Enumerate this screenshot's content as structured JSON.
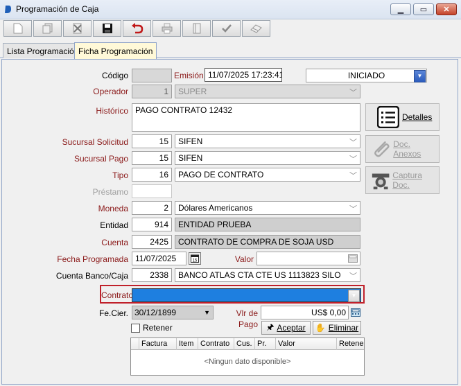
{
  "window": {
    "title": "Programación de Caja",
    "controls": {
      "minimize": "▁",
      "maximize": "▭",
      "close": "✕"
    }
  },
  "toolbar": {
    "buttons": [
      {
        "name": "new",
        "icon": "new-document-icon"
      },
      {
        "name": "copy",
        "icon": "copy-document-icon"
      },
      {
        "name": "delete",
        "icon": "delete-document-icon"
      },
      {
        "name": "save",
        "icon": "floppy-disk-icon"
      },
      {
        "name": "undo",
        "icon": "undo-arrow-icon"
      },
      {
        "name": "print",
        "icon": "printer-icon"
      },
      {
        "name": "attach",
        "icon": "notebook-icon"
      },
      {
        "name": "approve",
        "icon": "check-icon"
      },
      {
        "name": "eraser",
        "icon": "eraser-icon"
      }
    ]
  },
  "tabs": [
    {
      "label": "Lista Programación",
      "active": false
    },
    {
      "label": "Ficha Programación",
      "active": true
    }
  ],
  "form": {
    "codigo": {
      "label": "Código",
      "value": ""
    },
    "emision": {
      "label": "Emisión",
      "value": "11/07/2025 17:23:41"
    },
    "estado": {
      "value": "INICIADO"
    },
    "operador": {
      "label": "Operador",
      "code": "1",
      "name": "SUPER"
    },
    "historico": {
      "label": "Histórico",
      "value": "PAGO CONTRATO 12432"
    },
    "sucursal_solicitud": {
      "label": "Sucursal Solicitud",
      "code": "15",
      "name": "SIFEN"
    },
    "sucursal_pago": {
      "label": "Sucursal Pago",
      "code": "15",
      "name": "SIFEN"
    },
    "tipo": {
      "label": "Tipo",
      "code": "16",
      "name": "PAGO DE CONTRATO"
    },
    "prestamo": {
      "label": "Préstamo",
      "value": ""
    },
    "moneda": {
      "label": "Moneda",
      "code": "2",
      "name": "Dólares Americanos"
    },
    "entidad": {
      "label": "Entidad",
      "code": "914",
      "name": "ENTIDAD PRUEBA"
    },
    "cuenta": {
      "label": "Cuenta",
      "code": "2425",
      "name": "CONTRATO DE COMPRA DE SOJA USD"
    },
    "fecha_programada": {
      "label": "Fecha Programada",
      "value": "11/07/2025"
    },
    "valor": {
      "label": "Valor",
      "value": ""
    },
    "cuenta_banco": {
      "label": "Cuenta Banco/Caja",
      "code": "2338",
      "name": "BANCO ATLAS CTA CTE US 1113823 SILO"
    },
    "contrato": {
      "label": "Contrato",
      "value": ""
    },
    "fe_cier": {
      "label": "Fe.Cier.",
      "value": "30/12/1899"
    },
    "vlr_pago": {
      "label": "Vlr de Pago",
      "value": "US$ 0,00"
    },
    "retener": {
      "label": "Retener",
      "checked": false
    }
  },
  "side_buttons": {
    "detalles": "Detalles",
    "doc_anexos": "Doc. Anexos",
    "captura_doc": "Captura Doc."
  },
  "actions": {
    "aceptar": "Aceptar",
    "eliminar": "Eliminar"
  },
  "grid": {
    "columns": [
      "Factura",
      "Item",
      "Contrato",
      "Cus.",
      "Pr.",
      "Valor",
      "Retene"
    ],
    "empty_text": "<Ningun dato disponible>"
  },
  "colors": {
    "label_red": "#8b1a1a",
    "highlight_border": "#c0202a",
    "selection_blue": "#1e7fe0"
  }
}
